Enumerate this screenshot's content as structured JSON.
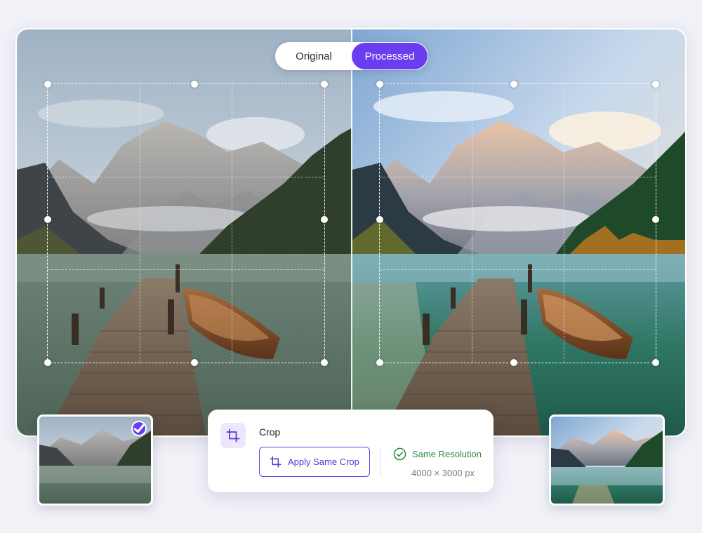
{
  "view_toggle": {
    "options": [
      {
        "label": "Original",
        "active": false
      },
      {
        "label": "Processed",
        "active": true
      }
    ]
  },
  "crop_panel": {
    "title": "Crop",
    "apply_button_label": "Apply Same Crop",
    "status_label": "Same Resolution",
    "dimensions": "4000 × 3000 px"
  },
  "thumbnails": [
    {
      "selected": true
    },
    {
      "selected": false
    }
  ],
  "colors": {
    "accent": "#6a3ef0",
    "success": "#2a8a3e",
    "background": "#f1f2f8"
  },
  "icons": [
    "crop-icon",
    "check-icon",
    "check-circle-icon"
  ]
}
